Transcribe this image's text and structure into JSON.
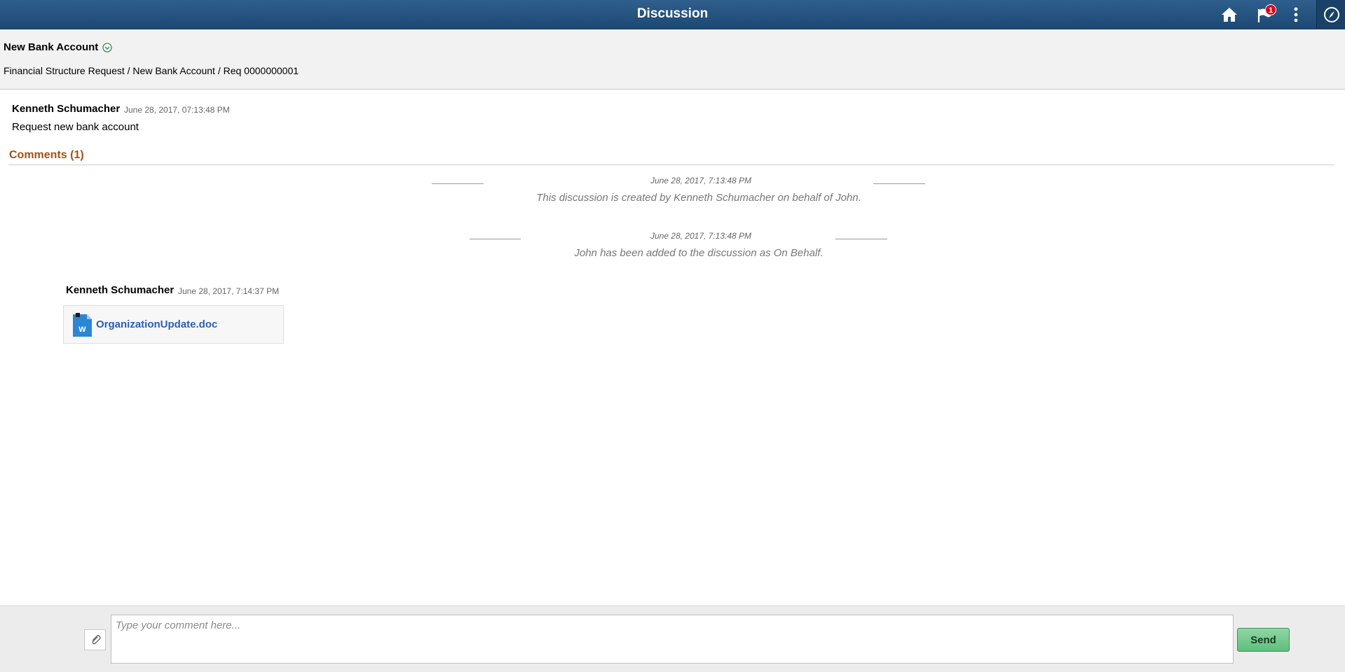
{
  "header": {
    "title": "Discussion",
    "notification_count": "1",
    "icons": [
      "home-icon",
      "flag-icon",
      "more-options-icon",
      "navigator-icon"
    ]
  },
  "transaction": {
    "title": "New Bank Account",
    "breadcrumb": "Financial Structure Request / New Bank Account / Req 0000000001"
  },
  "post": {
    "author": "Kenneth Schumacher",
    "timestamp": "June 28, 2017,  07:13:48 PM",
    "text": "Request new bank account"
  },
  "comments": {
    "header": "Comments (1)",
    "system_messages": [
      {
        "timestamp": "June 28, 2017,  7:13:48 PM",
        "text": "This discussion is created by Kenneth Schumacher on behalf of John."
      },
      {
        "timestamp": "June 28, 2017,  7:13:48 PM",
        "text": "John has been added to the discussion as On Behalf."
      }
    ],
    "items": [
      {
        "author": "Kenneth Schumacher",
        "timestamp": "June 28, 2017,  7:14:37 PM",
        "attachment": "OrganizationUpdate.doc"
      }
    ]
  },
  "footer": {
    "placeholder": "Type your comment here...",
    "send_label": "Send"
  },
  "colors": {
    "header_bg": "#24507c",
    "comments_header": "#a15214",
    "link": "#2a5fb0",
    "send_bg": "#6cc68a",
    "badge": "#e0001a"
  }
}
